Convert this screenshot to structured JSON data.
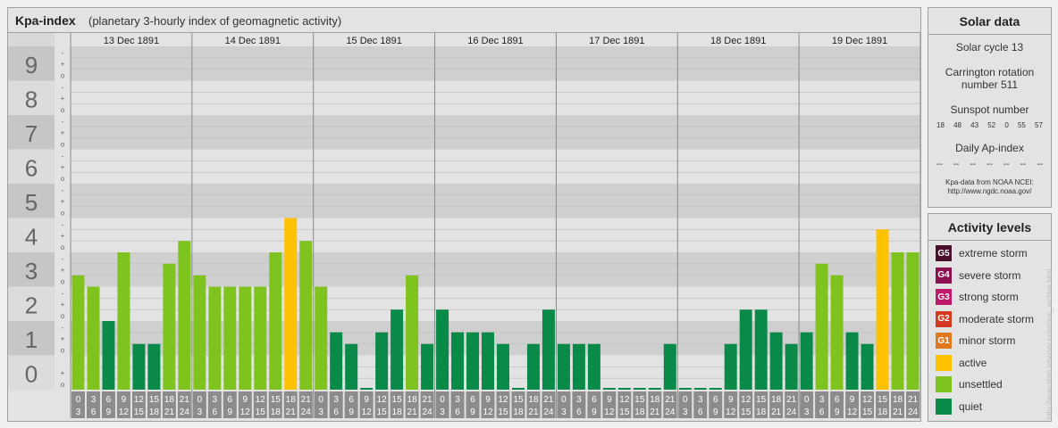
{
  "header": {
    "title": "Kpa-index",
    "subtitle": "(planetary 3-hourly index of geomagnetic activity)"
  },
  "chart_data": {
    "type": "bar",
    "days": [
      "13 Dec 1891",
      "14 Dec 1891",
      "15 Dec 1891",
      "16 Dec 1891",
      "17 Dec 1891",
      "18 Dec 1891",
      "19 Dec 1891"
    ],
    "y_labels": [
      "0",
      "1",
      "2",
      "3",
      "4",
      "5",
      "6",
      "7",
      "8",
      "9"
    ],
    "ylim": [
      0,
      9
    ],
    "interval_start_labels": [
      "0",
      "3",
      "6",
      "9",
      "12",
      "15",
      "18",
      "21"
    ],
    "interval_end_labels": [
      "3",
      "6",
      "9",
      "12",
      "15",
      "18",
      "21",
      "24"
    ],
    "values": [
      [
        2.33,
        2,
        1,
        3,
        0.33,
        0.33,
        2.67,
        3.33
      ],
      [
        2.33,
        2,
        2,
        2,
        2,
        3,
        4,
        3.33
      ],
      [
        2,
        0.67,
        0.33,
        0,
        0.67,
        1.33,
        2.33,
        0.33
      ],
      [
        1.33,
        0.67,
        0.67,
        0.67,
        0.33,
        0,
        0.33,
        1.33
      ],
      [
        0.33,
        0.33,
        0.33,
        0,
        0,
        0,
        0,
        0.33
      ],
      [
        0,
        0,
        0,
        0.33,
        1.33,
        1.33,
        0.67,
        0.33
      ],
      [
        0.67,
        2.67,
        2.33,
        0.67,
        0.33,
        3.67,
        3,
        3
      ]
    ],
    "colors": {
      "quiet": "#0a8a48",
      "unsettled": "#7ec31e",
      "active": "#ffc200",
      "minor_storm": "#e07820",
      "moderate_storm": "#d43a1f",
      "strong_storm": "#c0186a",
      "severe_storm": "#8a1050",
      "extreme_storm": "#4a0f2a"
    },
    "grid": true
  },
  "solar": {
    "header": "Solar data",
    "cycle": "Solar cycle 13",
    "carrington_line1": "Carrington rotation",
    "carrington_line2": "number 511",
    "sunspot_title": "Sunspot number",
    "sunspot_values": [
      "18",
      "48",
      "43",
      "52",
      "0",
      "55",
      "57"
    ],
    "ap_title": "Daily Ap-index",
    "ap_values": [
      "--",
      "--",
      "--",
      "--",
      "--",
      "--",
      "--"
    ],
    "source_line1": "Kpa-data from NOAA NCEI:",
    "source_line2": "http://www.ngdc.noaa.gov/"
  },
  "legend": {
    "header": "Activity levels",
    "items": [
      {
        "code": "G5",
        "label": "extreme storm",
        "color": "#4a0f2a"
      },
      {
        "code": "G4",
        "label": "severe storm",
        "color": "#8a1050"
      },
      {
        "code": "G3",
        "label": "strong storm",
        "color": "#c0186a"
      },
      {
        "code": "G2",
        "label": "moderate storm",
        "color": "#d43a1f"
      },
      {
        "code": "G1",
        "label": "minor storm",
        "color": "#e07820"
      },
      {
        "code": "",
        "label": "active",
        "color": "#ffc200"
      },
      {
        "code": "",
        "label": "unsettled",
        "color": "#7ec31e"
      },
      {
        "code": "",
        "label": "quiet",
        "color": "#0a8a48"
      }
    ]
  },
  "watermark": "http://www.tesis.lebedev.ru/en/sun_archive.html"
}
